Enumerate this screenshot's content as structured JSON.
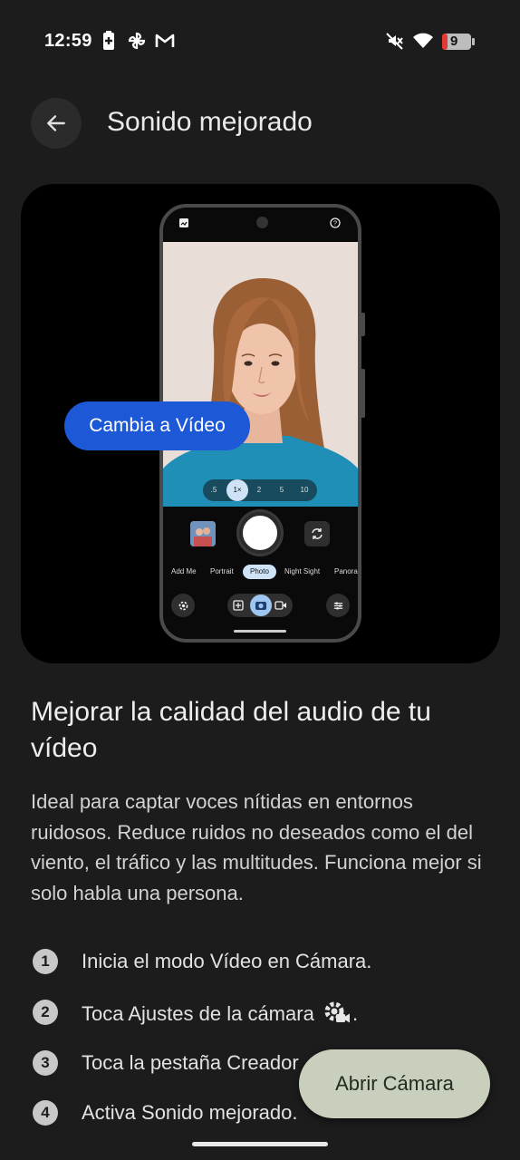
{
  "status_bar": {
    "time": "12:59",
    "battery_level": "9",
    "icons": [
      "battery-saver-icon",
      "pinwheel-icon",
      "gmail-icon",
      "mute-icon",
      "wifi-icon",
      "battery-icon"
    ]
  },
  "header": {
    "title": "Sonido mejorado"
  },
  "hero": {
    "bubble_label": "Cambia a Vídeo",
    "zoom_options": [
      ".5",
      "1×",
      "2",
      "5",
      "10"
    ],
    "zoom_selected": "1×",
    "modes": [
      "Add Me",
      "Portrait",
      "Photo",
      "Night Sight",
      "Panora"
    ],
    "mode_selected": "Photo"
  },
  "content": {
    "heading": "Mejorar la calidad del audio de tu vídeo",
    "description": "Ideal para captar voces nítidas en entornos ruidosos. Reduce ruidos no deseados como el del viento, el tráfico y las multitudes. Funciona mejor si solo habla una persona.",
    "steps": [
      {
        "number": "1",
        "text": "Inicia el modo Vídeo en Cámara."
      },
      {
        "number": "2",
        "text": "Toca Ajustes de la cámara",
        "suffix": "."
      },
      {
        "number": "3",
        "text": "Toca la pestaña Creador"
      },
      {
        "number": "4",
        "text": "Activa Sonido mejorado."
      }
    ]
  },
  "actions": {
    "open_camera": "Abrir Cámara"
  },
  "colors": {
    "background": "#1c1c1c",
    "bubble": "#1d58d6",
    "open_camera_button": "#c9cfbd",
    "battery_low": "#e53935"
  }
}
